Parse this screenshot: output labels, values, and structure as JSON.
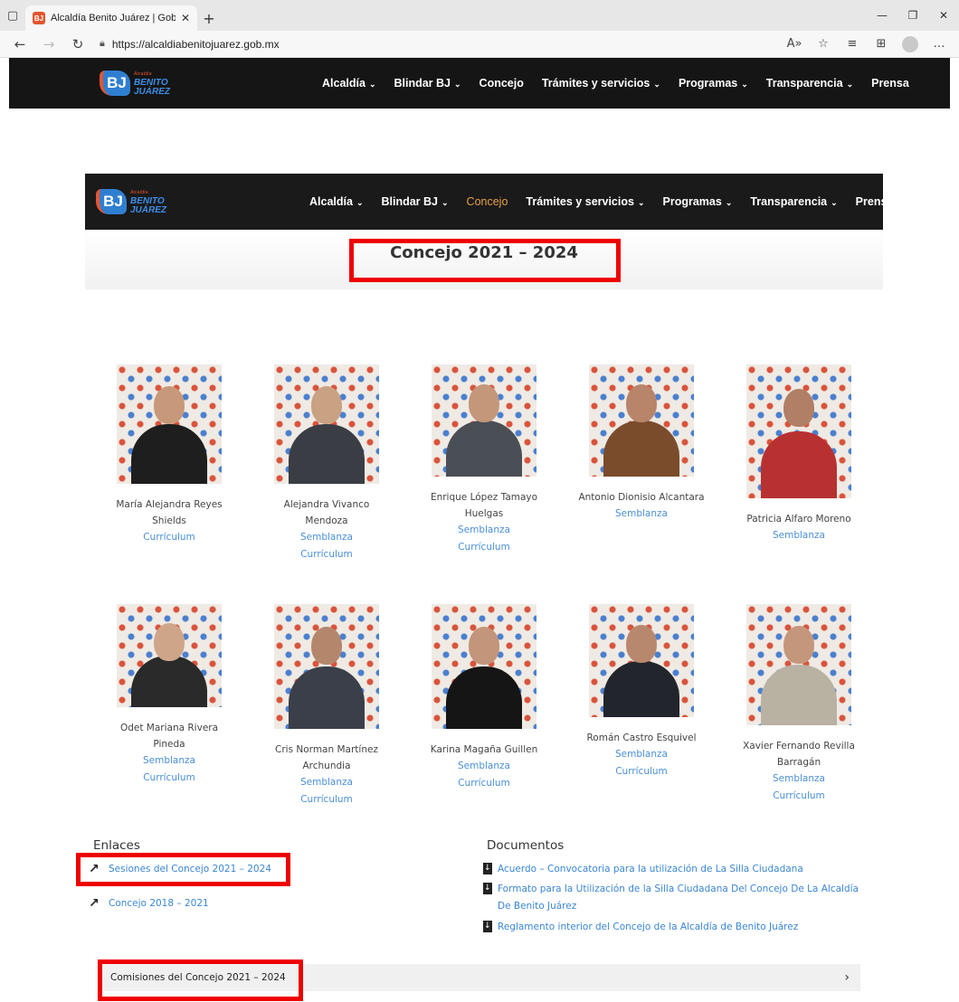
{
  "browser": {
    "tab_title": "Alcaldía Benito Juárez | Gobierno",
    "url": "https://alcaldiabenitojuarez.gob.mx"
  },
  "site": {
    "logo_letters": "BJ",
    "logo_small": "Alcaldía",
    "logo_line1": "BENITO",
    "logo_line2": "JUÁREZ",
    "menu": [
      {
        "label": "Alcaldía",
        "chevron": true
      },
      {
        "label": "Blindar BJ",
        "chevron": true
      },
      {
        "label": "Concejo",
        "chevron": false
      },
      {
        "label": "Trámites y servicios",
        "chevron": true
      },
      {
        "label": "Programas",
        "chevron": true
      },
      {
        "label": "Transparencia",
        "chevron": true
      },
      {
        "label": "Prensa",
        "chevron": false
      }
    ],
    "active_menu": "Concejo"
  },
  "page_title": "Concejo 2021 – 2024",
  "people_row1": [
    {
      "name": "María Alejandra Reyes Shields",
      "links": [
        "Currículum"
      ],
      "shirt": "#1e1e1e",
      "skin": "#c8987a"
    },
    {
      "name": "Alejandra Vivanco Mendoza",
      "links": [
        "Semblanza",
        "Currículum"
      ],
      "shirt": "#3a3d44",
      "skin": "#c9a183"
    },
    {
      "name": "Enrique López Tamayo Huelgas",
      "links": [
        "Semblanza",
        "Currículum"
      ],
      "shirt": "#4a4e55",
      "skin": "#c4977a"
    },
    {
      "name": "Antonio Dionisio Alcantara",
      "links": [
        "Semblanza"
      ],
      "shirt": "#7a4c2c",
      "skin": "#b8856a"
    },
    {
      "name": "Patricia Alfaro Moreno",
      "links": [
        "Semblanza"
      ],
      "shirt": "#b83131",
      "skin": "#b07f66"
    }
  ],
  "people_row2": [
    {
      "name": "Odet Mariana Rivera Pineda",
      "links": [
        "Semblanza",
        "Currículum"
      ],
      "shirt": "#2a2a2a",
      "skin": "#cfa58a"
    },
    {
      "name": "Cris Norman Martínez Archundia",
      "links": [
        "Semblanza",
        "Currículum"
      ],
      "shirt": "#3b3f4a",
      "skin": "#b4876d"
    },
    {
      "name": "Karina Magaña Guillen",
      "links": [
        "Semblanza",
        "Currículum"
      ],
      "shirt": "#151515",
      "skin": "#c3957a"
    },
    {
      "name": "Román Castro Esquivel",
      "links": [
        "Semblanza",
        "Currículum"
      ],
      "shirt": "#22252c",
      "skin": "#b8886e"
    },
    {
      "name": "Xavier Fernando Revilla Barragán",
      "links": [
        "Semblanza",
        "Currículum"
      ],
      "shirt": "#b9b2a3",
      "skin": "#c4977c"
    }
  ],
  "enlaces": {
    "title": "Enlaces",
    "items": [
      "Sesiones del Concejo 2021 – 2024",
      "Concejo 2018 – 2021"
    ]
  },
  "documentos": {
    "title": "Documentos",
    "items": [
      {
        "line1": "Acuerdo – Convocatoria para la utilización de La Silla Ciudadana",
        "line2": ""
      },
      {
        "line1": "Formato para la Utilización de la Silla Ciudadana Del Concejo De La Alcaldía",
        "line2": "De Benito Juárez"
      },
      {
        "line1": "Reglamento interior del Concejo de la Alcaldía de Benito Juárez",
        "line2": ""
      }
    ]
  },
  "accordion": {
    "label": "Comisiones del Concejo 2021 – 2024"
  },
  "colors": {
    "highlight": "#ee0000",
    "link": "#3a86d5",
    "active_menu": "#e8a045"
  }
}
